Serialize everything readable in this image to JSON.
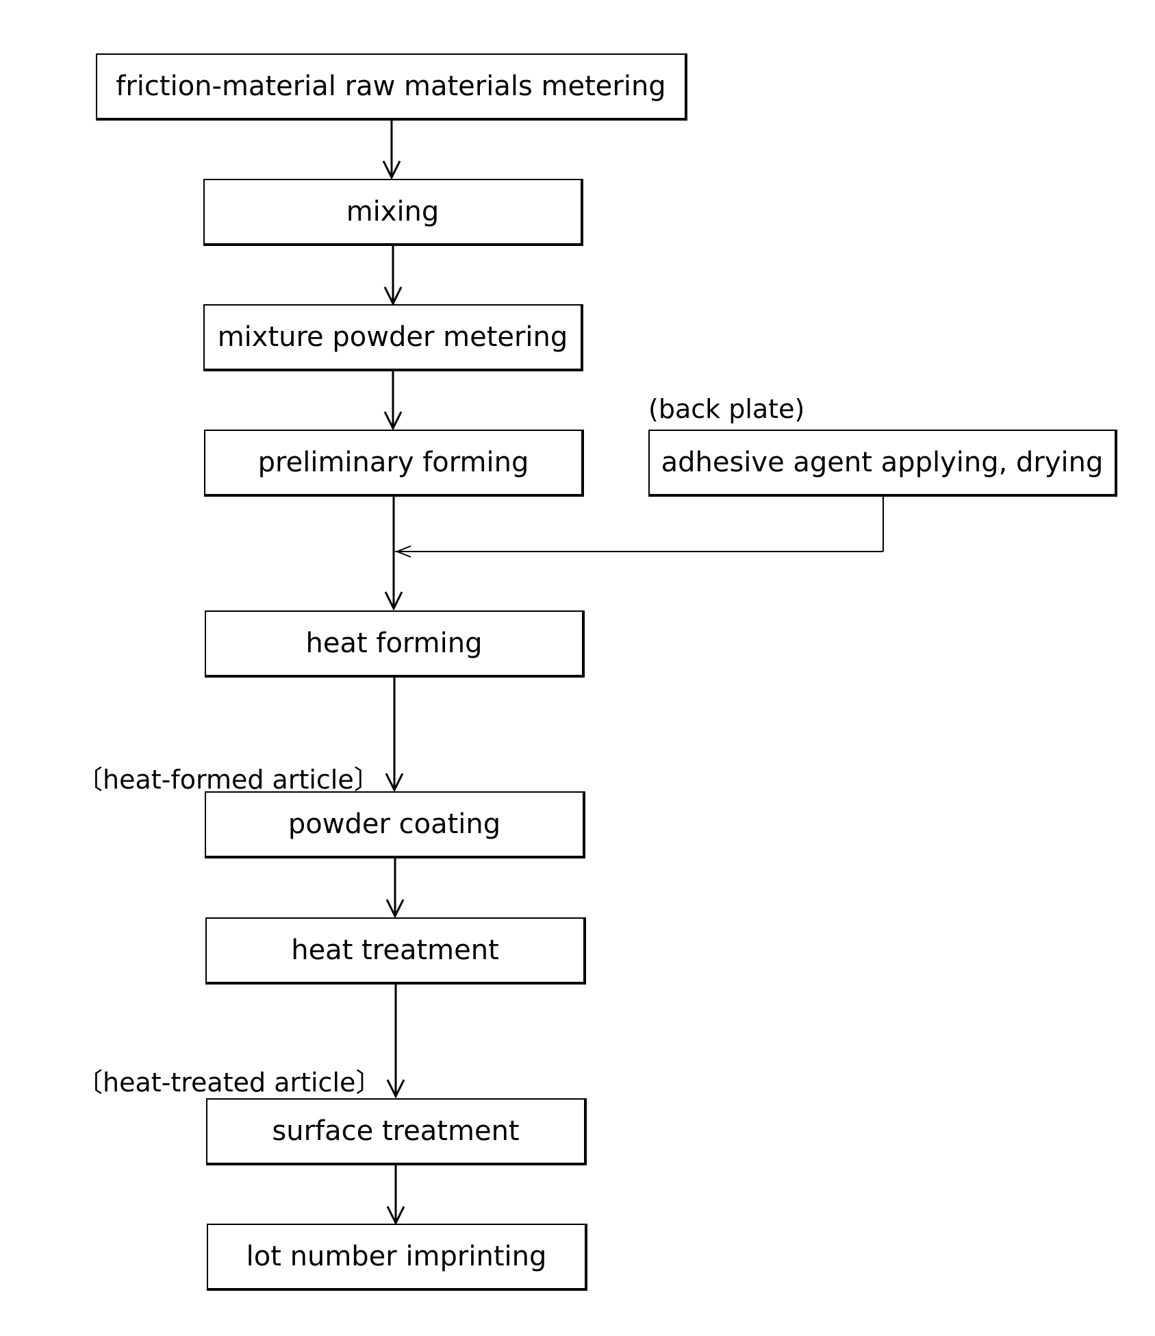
{
  "diagram": {
    "type": "process-flowchart",
    "steps": [
      {
        "id": "s1",
        "label": "friction-material raw materials metering"
      },
      {
        "id": "s2",
        "label": "mixing"
      },
      {
        "id": "s3",
        "label": "mixture powder metering"
      },
      {
        "id": "s4",
        "label": "preliminary forming"
      },
      {
        "id": "s5",
        "label": "heat forming"
      },
      {
        "id": "s6",
        "label": "powder coating"
      },
      {
        "id": "s7",
        "label": "heat treatment"
      },
      {
        "id": "s8",
        "label": "surface treatment"
      },
      {
        "id": "s9",
        "label": "lot number imprinting"
      }
    ],
    "side_branch": {
      "label": "adhesive agent applying, drying",
      "annotation": "(back plate)",
      "joins_before": "heat forming"
    },
    "annotations": {
      "heat_formed": "〔heat-formed article〕",
      "heat_treated": "〔heat-treated article〕"
    }
  }
}
